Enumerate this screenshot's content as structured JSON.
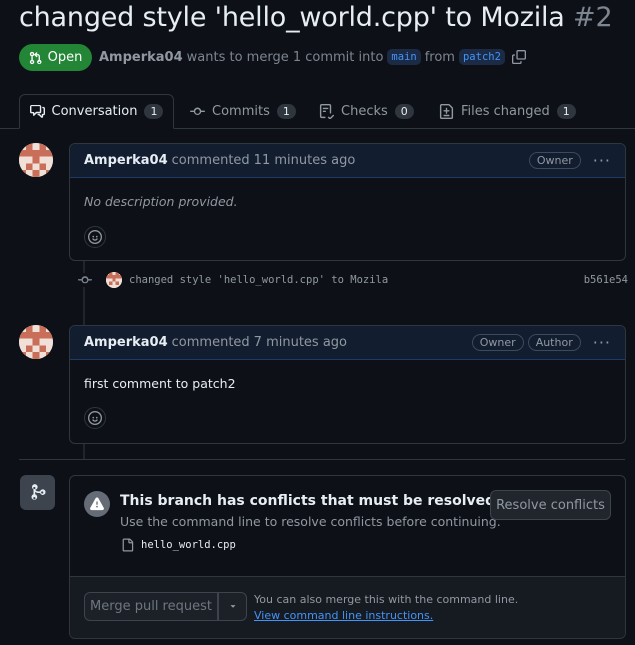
{
  "pr": {
    "title": "changed style 'hello_world.cpp' to Mozila",
    "number": "#2",
    "state": "Open",
    "author": "Amperka04",
    "summary_mid": "wants to merge 1 commit into",
    "base_branch": "main",
    "from_word": "from",
    "head_branch": "patch2"
  },
  "tabs": [
    {
      "label": "Conversation",
      "count": "1"
    },
    {
      "label": "Commits",
      "count": "1"
    },
    {
      "label": "Checks",
      "count": "0"
    },
    {
      "label": "Files changed",
      "count": "1"
    }
  ],
  "comments": [
    {
      "author": "Amperka04",
      "action": "commented",
      "time": "11 minutes ago",
      "badges": [
        "Owner"
      ],
      "body": "No description provided."
    },
    {
      "author": "Amperka04",
      "action": "commented",
      "time": "7 minutes ago",
      "badges": [
        "Owner",
        "Author"
      ],
      "body": "first comment to patch2"
    }
  ],
  "commit": {
    "message": "changed style 'hello_world.cpp' to Mozila",
    "sha": "b561e54"
  },
  "merge": {
    "conflict_title": "This branch has conflicts that must be resolved",
    "conflict_sub": "Use the command line to resolve conflicts before continuing.",
    "resolve_label": "Resolve conflicts",
    "conflict_file": "hello_world.cpp",
    "merge_label": "Merge pull request",
    "cli_text": "You can also merge this with the command line.",
    "cli_link": "View command line instructions."
  },
  "colors": {
    "open": "#238636",
    "accent": "#4493f8",
    "bg": "#0d1117"
  },
  "icons": [
    "git-pull-request-icon",
    "copy-icon",
    "comment-icon",
    "commit-icon",
    "checklist-icon",
    "file-diff-icon",
    "smiley-icon",
    "alert-icon",
    "file-icon",
    "git-merge-icon",
    "triangle-down-icon",
    "kebab-icon"
  ]
}
